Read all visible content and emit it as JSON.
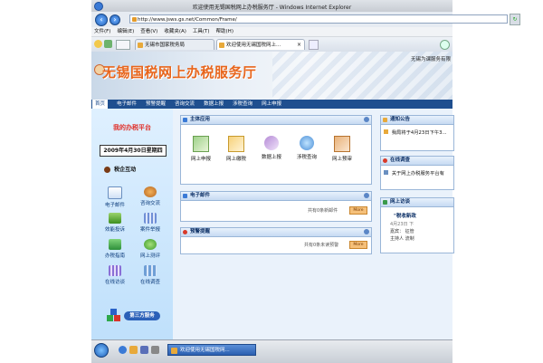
{
  "window": {
    "title": "欢迎使用无锡国税网上办税服务厅 - Windows Internet Explorer"
  },
  "address": {
    "url": "http://www.jsws.gs.net/Common/Frame/"
  },
  "menu": [
    "文件(F)",
    "编辑(E)",
    "查看(V)",
    "收藏夹(A)",
    "工具(T)",
    "帮助(H)"
  ],
  "tabs": [
    {
      "label": "无锡市国家税务局"
    },
    {
      "label": "欢迎使用无锡国税网上..."
    }
  ],
  "banner": {
    "title": "无锡国税网上办税服务厅",
    "right_text": "无锡为课服务有限"
  },
  "nav": [
    "首页",
    "电子邮件",
    "预警提醒",
    "咨询交流",
    "数据上报",
    "涉税查询",
    "网上申报"
  ],
  "sidebar": {
    "title": "我的办税平台",
    "date": "2009年4月30日星期四",
    "section": "税企互动",
    "items": [
      {
        "label": "电子邮件"
      },
      {
        "label": "咨询交流"
      },
      {
        "label": "效能投诉"
      },
      {
        "label": "案件举报"
      },
      {
        "label": "办税指南"
      },
      {
        "label": "网上测评"
      },
      {
        "label": "在线访谈"
      },
      {
        "label": "在线调查"
      }
    ],
    "third_party": "第三方服务"
  },
  "main": {
    "apps_title": "主体应用",
    "apps": [
      {
        "label": "网上申报"
      },
      {
        "label": "网上缴税"
      },
      {
        "label": "数据上报"
      },
      {
        "label": "涉税查询"
      },
      {
        "label": "网上预审"
      }
    ],
    "email": {
      "title": "电子邮件",
      "count_text": "共有0条新邮件",
      "more": "More"
    },
    "warning": {
      "title": "预警提醒",
      "count_text": "共有0条未读预警",
      "more": "More"
    }
  },
  "right": {
    "notice": {
      "title": "通知公告",
      "text": "我局将于4月23日下午3..."
    },
    "survey": {
      "title": "在线调查",
      "text": "关于网上办税服务平台有"
    },
    "interview": {
      "title": "网上访谈",
      "headline": "\"税收新政",
      "date": "4月23日 下",
      "guest": "嘉宾：   征管",
      "host": "主持人    流制"
    }
  },
  "taskbar": {
    "task": "欢迎使用无锡国税网..."
  }
}
